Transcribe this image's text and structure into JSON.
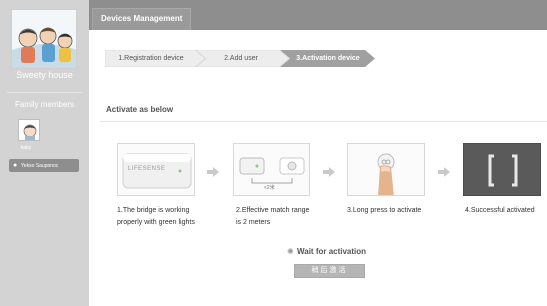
{
  "sidebar": {
    "house_name": "Sweety house",
    "members_title": "Family members",
    "member_name": "baby",
    "user_chip": "Yekso Sauponoc"
  },
  "header": {
    "tab": "Devices Management"
  },
  "steps": [
    {
      "label": "1.Registration device"
    },
    {
      "label": "2.Add user"
    },
    {
      "label": "3.Activation device"
    }
  ],
  "main": {
    "activate_title": "Activate as below",
    "bridge_brand": "LIFESENSE",
    "range_label": "<2米",
    "captions": [
      {
        "line1": "1.The bridge is working",
        "line2": "properly with green lights"
      },
      {
        "line1": "2.Effective match range",
        "line2": "is 2 meters"
      },
      {
        "line1": "3.Long press to activate",
        "line2": ""
      },
      {
        "line1": "4.Successful activated",
        "line2": ""
      }
    ],
    "wait_text": "Wait for activation",
    "later_button": "稍后激活"
  },
  "colors": {
    "sidebar_bg": "#d3d3d3",
    "header_bg": "#8e8e8e",
    "step_inactive": "#ededed",
    "step_active": "#a0a0a0"
  }
}
